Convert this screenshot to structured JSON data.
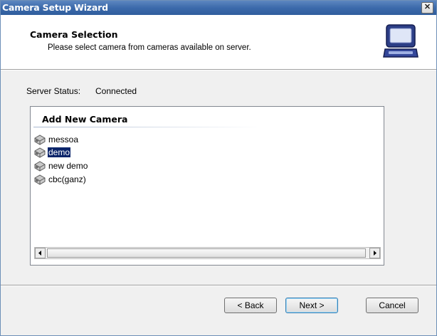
{
  "window": {
    "title": "Camera Setup Wizard",
    "close_glyph": "✕"
  },
  "header": {
    "title": "Camera Selection",
    "subtitle": "Please select camera from cameras available on server.",
    "icon": "laptop-icon"
  },
  "status": {
    "label": "Server Status:",
    "value": "Connected"
  },
  "camera_list": {
    "header": "Add New Camera",
    "items": [
      {
        "label": "messoa",
        "icon": "camera-icon",
        "selected": false
      },
      {
        "label": "demo",
        "icon": "camera-icon",
        "selected": true
      },
      {
        "label": "new demo",
        "icon": "camera-icon",
        "selected": false
      },
      {
        "label": "cbc(ganz)",
        "icon": "camera-icon",
        "selected": false
      }
    ]
  },
  "buttons": {
    "back": "< Back",
    "next": "Next >",
    "cancel": "Cancel"
  },
  "colors": {
    "selection": "#0a246a",
    "titlebar": "#3c6aab"
  }
}
